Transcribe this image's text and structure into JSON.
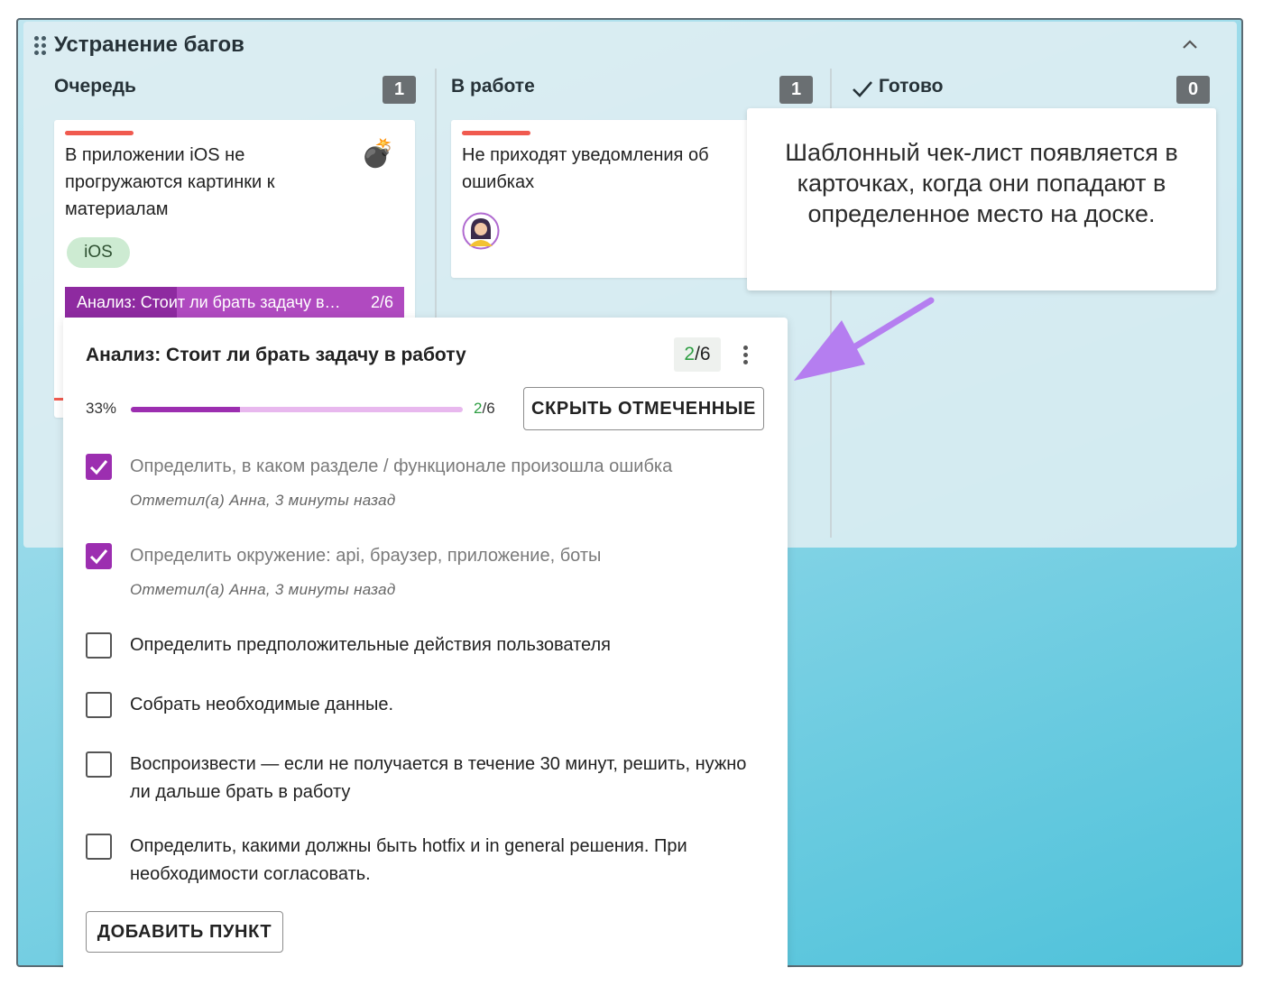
{
  "board": {
    "title": "Устранение багов",
    "columns": [
      {
        "name": "Очередь",
        "count": "1"
      },
      {
        "name": "В работе",
        "count": "1"
      },
      {
        "name": "Готово",
        "count": "0",
        "check_icon": "checkmark-icon"
      }
    ]
  },
  "cards": {
    "queue_card": {
      "title": "В приложении iOS не прогружаются картинки к материалам",
      "tag": "iOS",
      "emoji": "💣",
      "checklist_strip": "Анализ: Стоит ли брать задачу в…",
      "checklist_strip_count": "2/6",
      "priority_color": "#f05a4f"
    },
    "work_card": {
      "title": "Не приходят уведомления об ошибках",
      "avatar_icon": "user-avatar-icon",
      "priority_color": "#f05a4f"
    }
  },
  "tooltip": {
    "text": "Шаблонный чек-лист появляется в карточках, когда они попадают в определенное место на доске."
  },
  "checklist": {
    "title": "Анализ: Стоит ли брать задачу в работу",
    "done": "2",
    "total": "/6",
    "percent_label": "33%",
    "progress": 0.33,
    "hide_button": "СКРЫТЬ ОТМЕЧЕННЫЕ",
    "add_button": "ДОБАВИТЬ ПУНКТ",
    "items": [
      {
        "text": "Определить, в каком разделе / функционале произошла ошибка",
        "checked": true,
        "meta": "Отметил(а) Анна, 3 минуты назад"
      },
      {
        "text": "Определить окружение: api, браузер, приложение, боты",
        "checked": true,
        "meta": "Отметил(а) Анна, 3 минуты назад"
      },
      {
        "text": "Определить предположительные действия пользователя",
        "checked": false
      },
      {
        "text": "Собрать необходимые данные.",
        "checked": false
      },
      {
        "text": "Воспроизвести — если не получается в течение 30 минут, решить, нужно ли дальше брать в работу",
        "checked": false
      },
      {
        "text": "Определить, какими должны быть hotfix и in general решения. При необходимости согласовать.",
        "checked": false
      }
    ]
  },
  "colors": {
    "accent": "#9c2eb0",
    "accent_light": "#e8b8ee",
    "arrow": "#b57ef0",
    "count_badge": "#6a6f72"
  }
}
